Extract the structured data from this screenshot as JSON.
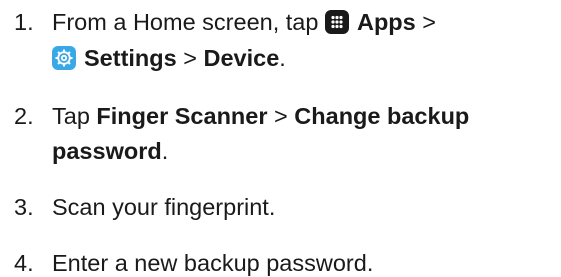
{
  "steps": [
    {
      "number": "1.",
      "line1": {
        "prefix": "From a Home screen, tap ",
        "icon1": "apps-grid-icon",
        "apps": "Apps",
        "sep1": " >"
      },
      "line2": {
        "icon2": "settings-gear-icon",
        "settings": "Settings",
        "sep2": " > ",
        "device": "Device",
        "end": "."
      }
    },
    {
      "number": "2.",
      "line1": {
        "prefix": "Tap ",
        "finger_scanner": "Finger Scanner",
        "sep": " > ",
        "change_backup": "Change backup"
      },
      "line2": {
        "password": "password",
        "end": "."
      }
    },
    {
      "number": "3.",
      "text": "Scan your fingerprint."
    },
    {
      "number": "4.",
      "text": "Enter a new backup password."
    }
  ],
  "colors": {
    "text": "#1a1a1a",
    "apps_icon_bg": "#1a1a1a",
    "settings_icon_bg": "#3aa7e6"
  }
}
